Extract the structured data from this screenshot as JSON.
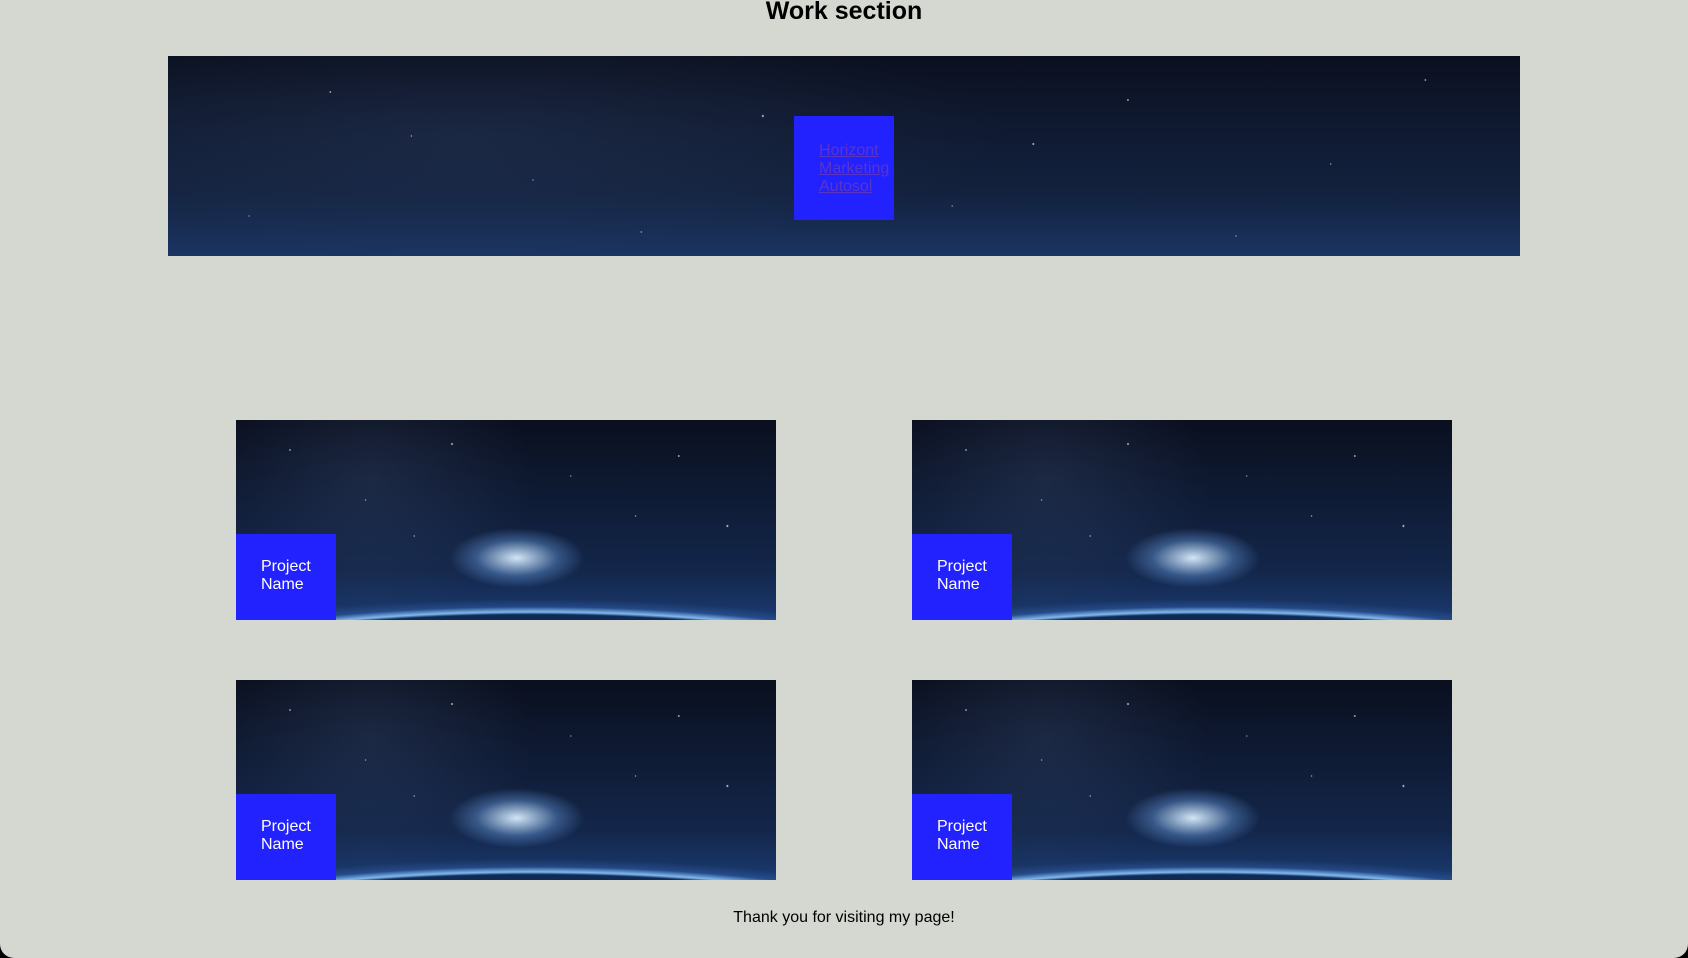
{
  "header": {
    "title": "Work section"
  },
  "nav": {
    "links": [
      "Horizont",
      "Marketing",
      "Autosol"
    ]
  },
  "projects": [
    {
      "label": "Project Name"
    },
    {
      "label": "Project Name"
    },
    {
      "label": "Project Name"
    },
    {
      "label": "Project Name"
    }
  ],
  "footer": {
    "text": "Thank you for visiting my page!"
  },
  "colors": {
    "page_bg": "#d5d8d1",
    "accent_blue": "#2222ff",
    "link": "#5a35c8",
    "text_white": "#ffffff"
  }
}
